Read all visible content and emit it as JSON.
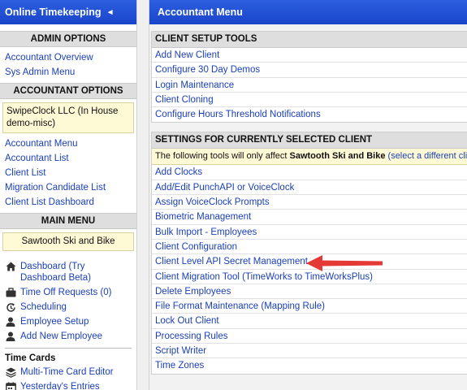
{
  "sidebar": {
    "title": "Online Timekeeping",
    "collapse_glyph": "◄",
    "admin_options": {
      "heading": "ADMIN OPTIONS",
      "links": [
        "Accountant Overview",
        "Sys Admin Menu"
      ]
    },
    "accountant_options": {
      "heading": "ACCOUNTANT OPTIONS",
      "selected_account": "SwipeClock LLC (In House demo-misc)",
      "links": [
        "Accountant Menu",
        "Accountant List",
        "Client List",
        "Migration Candidate List",
        "Client List Dashboard"
      ]
    },
    "main_menu": {
      "heading": "MAIN MENU",
      "selected_client": "Sawtooth Ski and Bike",
      "items": [
        {
          "label": "Dashboard (Try Dashboard Beta)",
          "icon": "home-icon"
        },
        {
          "label": "Time Off Requests (0)",
          "icon": "briefcase-icon"
        },
        {
          "label": "Scheduling",
          "icon": "clock-cycle-icon"
        },
        {
          "label": "Employee Setup",
          "icon": "person-icon"
        },
        {
          "label": "Add New Employee",
          "icon": "person-icon"
        }
      ]
    },
    "time_cards": {
      "heading": "Time Cards",
      "items": [
        {
          "label": "Multi-Time Card Editor",
          "icon": "layers-icon"
        },
        {
          "label": "Yesterday's Entries",
          "icon": "calendar-icon"
        }
      ]
    }
  },
  "main": {
    "title": "Accountant Menu",
    "client_setup": {
      "heading": "CLIENT SETUP TOOLS",
      "links": [
        "Add New Client",
        "Configure 30 Day Demos",
        "Login Maintenance",
        "Client Cloning",
        "Configure Hours Threshold Notifications"
      ]
    },
    "client_settings": {
      "heading": "SETTINGS FOR CURRENTLY SELECTED CLIENT",
      "notice_prefix": "The following tools will only affect ",
      "notice_client": "Sawtooth Ski and Bike",
      "notice_link": "(select a different client)",
      "links": [
        "Add Clocks",
        "Add/Edit PunchAPI or VoiceClock",
        "Assign VoiceClock Prompts",
        "Biometric Management",
        "Bulk Import - Employees",
        "Client Configuration",
        "Client Level API Secret Management",
        "Client Migration Tool (TimeWorks to TimeWorksPlus)",
        "Delete Employees",
        "File Format Maintenance (Mapping Rule)",
        "Lock Out Client",
        "Processing Rules",
        "Script Writer",
        "Time Zones"
      ]
    }
  },
  "annotation_color": "#e53935"
}
